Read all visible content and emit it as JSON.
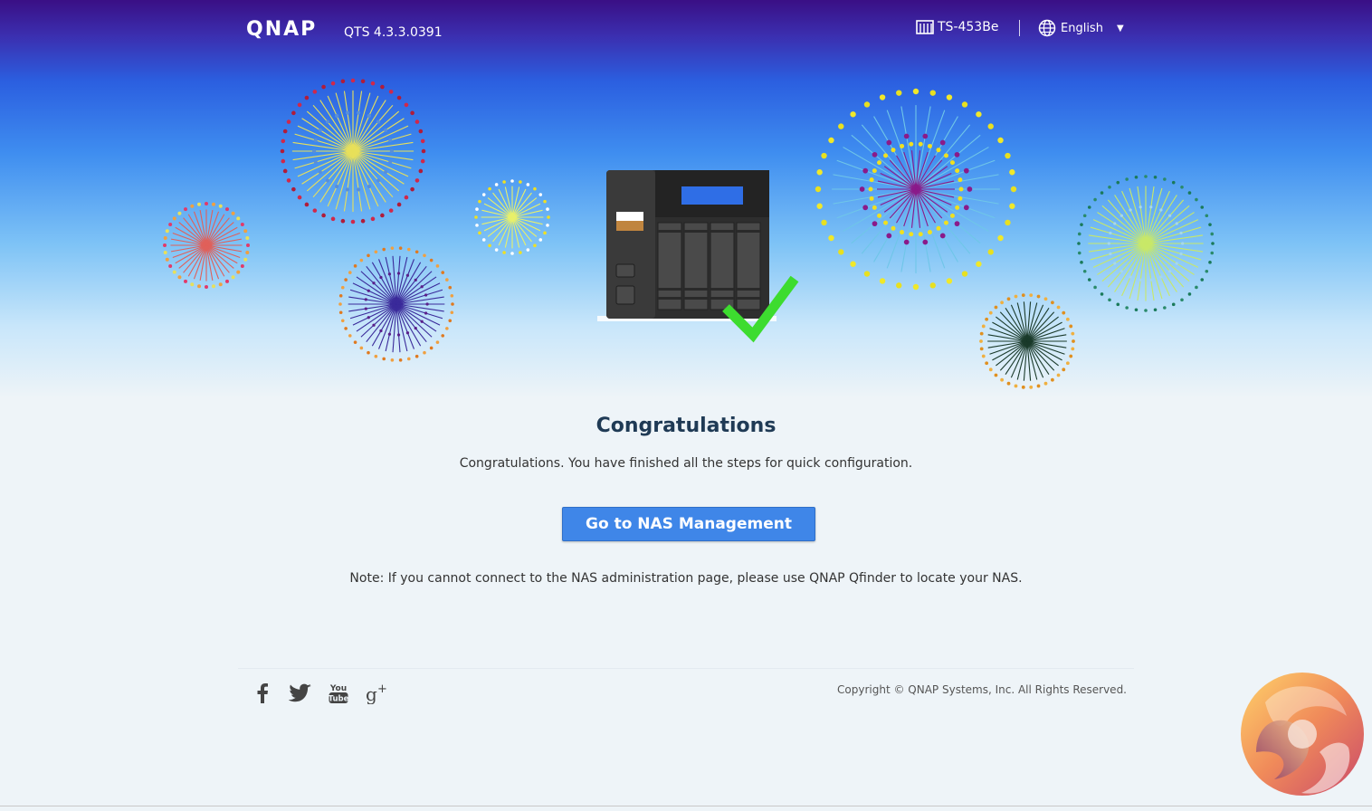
{
  "header": {
    "logo_text": "QNAP",
    "version": "QTS 4.3.3.0391",
    "model": "TS-453Be",
    "language": "English"
  },
  "main": {
    "title": "Congratulations",
    "subtitle": "Congratulations. You have finished all the steps for quick configuration.",
    "button_label": "Go to NAS Management",
    "note": "Note: If you cannot connect to the NAS administration page, please use QNAP Qfinder to locate your NAS."
  },
  "footer": {
    "social": [
      "facebook-icon",
      "twitter-icon",
      "youtube-icon",
      "google-plus-icon"
    ],
    "copyright": "Copyright © QNAP Systems, Inc. All Rights Reserved."
  },
  "colors": {
    "button": "#3f86e8",
    "check": "#3ddc2f",
    "header_top": "#3a0f85"
  }
}
